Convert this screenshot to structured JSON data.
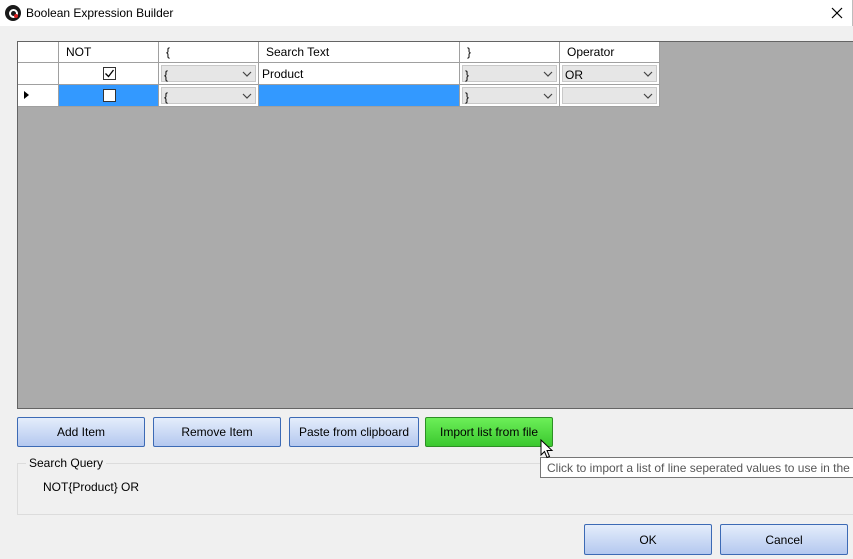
{
  "window": {
    "title": "Boolean Expression Builder"
  },
  "grid": {
    "columns": [
      "",
      "NOT",
      "{",
      "Search Text",
      "}",
      "Operator"
    ],
    "rows": [
      {
        "not_checked": true,
        "open": "{",
        "text": "Product",
        "close": "}",
        "operator": "OR",
        "selected": false,
        "current": false
      },
      {
        "not_checked": false,
        "open": "{",
        "text": "",
        "close": "}",
        "operator": "",
        "selected": true,
        "current": true
      }
    ]
  },
  "buttons": {
    "add": "Add Item",
    "remove": "Remove Item",
    "paste": "Paste from clipboard",
    "import": "Import list from file",
    "ok": "OK",
    "cancel": "Cancel"
  },
  "search_query": {
    "label": "Search Query",
    "value": "NOT{Product} OR"
  },
  "tooltip": "Click to import a list of line seperated values to use in the c",
  "colors": {
    "selection": "#3399ff",
    "grid_background": "#ababab",
    "import_button": "#4cd83e"
  },
  "icons": {
    "app": "app-logo-icon",
    "close": "close-icon",
    "dropdown": "chevron-down-icon",
    "row_indicator": "row-indicator-icon",
    "check": "check-icon",
    "cursor": "mouse-pointer-icon"
  }
}
